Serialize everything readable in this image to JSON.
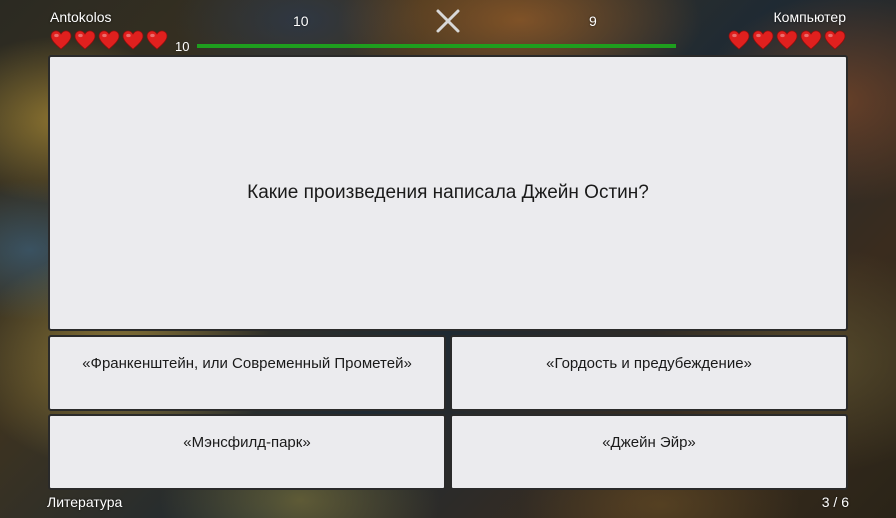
{
  "players": {
    "left": {
      "name": "Antokolos",
      "lives": 5,
      "score": "10"
    },
    "right": {
      "name": "Компьютер",
      "lives": 5,
      "score": "9"
    }
  },
  "timer": {
    "label": "10",
    "fraction": 1.0,
    "color": "#1e9e1e"
  },
  "close_icon": "close-icon",
  "heart_icon": "heart-icon",
  "heart_color": "#e0201e",
  "question": {
    "text": "Какие произведения написала Джейн Остин?"
  },
  "answers": [
    {
      "label": "«Франкенштейн, или Современный Прометей»"
    },
    {
      "label": "«Гордость и предубеждение»"
    },
    {
      "label": "«Мэнсфилд-парк»"
    },
    {
      "label": "«Джейн Эйр»"
    }
  ],
  "footer": {
    "category": "Литература",
    "progress": "3 / 6"
  }
}
